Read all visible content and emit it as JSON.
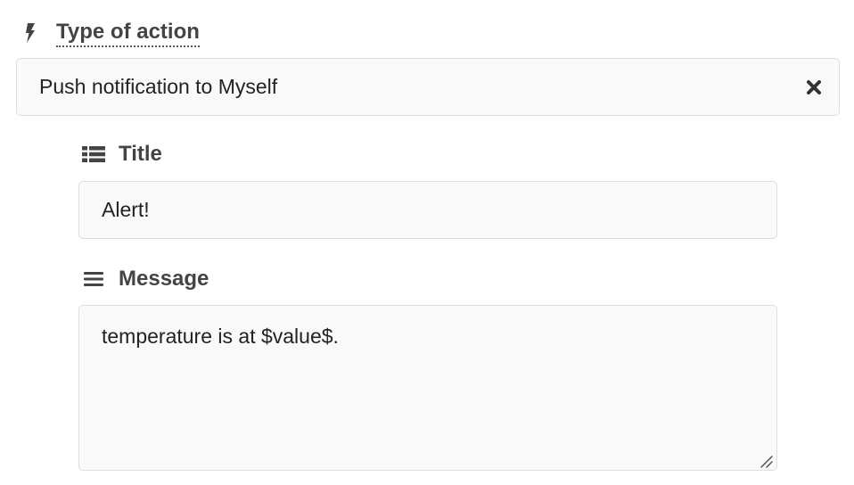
{
  "action_type": {
    "label": "Type of action",
    "icon": "bolt-icon",
    "selected_value": "Push notification to Myself",
    "clear_icon": "close-icon"
  },
  "title_field": {
    "label": "Title",
    "icon": "list-icon",
    "value": "Alert!"
  },
  "message_field": {
    "label": "Message",
    "icon": "menu-lines-icon",
    "value": "temperature is at $value$."
  },
  "colors": {
    "label_text": "#444444",
    "input_background": "#f9f9f9",
    "input_border": "#dedede",
    "input_text": "#222222"
  }
}
